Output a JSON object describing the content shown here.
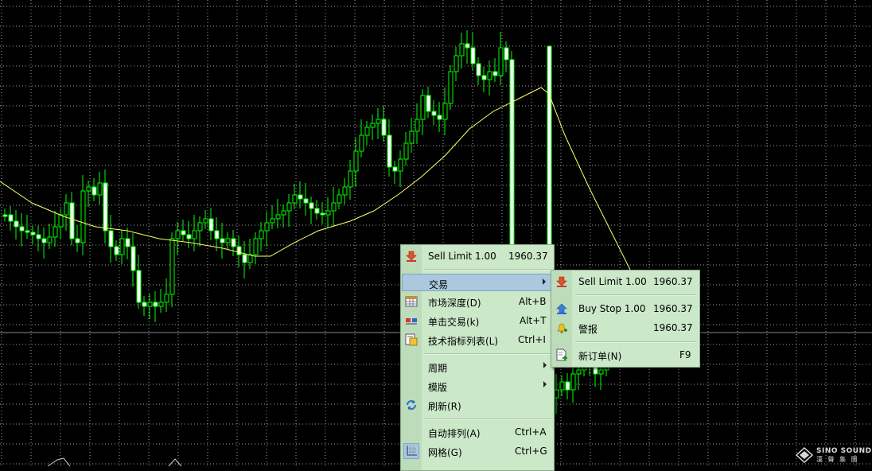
{
  "chart": {
    "bull_color": "#00ff00",
    "bear_color": "#00ff00",
    "ma_color": "#ffff66",
    "grid_color": "#a0a0a0",
    "background": "#000000",
    "price_line_color": "#8a8a8a"
  },
  "context_menu": {
    "top_item": {
      "label": "Sell Limit 1.00",
      "price": "1960.37",
      "icon": "sell-arrow-icon"
    },
    "items": [
      {
        "label": "交易",
        "shortcut": "",
        "icon": "",
        "submenu": true
      },
      {
        "label": "市场深度(D)",
        "shortcut": "Alt+B",
        "icon": "market-depth-icon"
      },
      {
        "label": "单击交易(k)",
        "shortcut": "Alt+T",
        "icon": "one-click-trading-icon"
      },
      {
        "label": "技术指标列表(L)",
        "shortcut": "Ctrl+I",
        "icon": "indicators-list-icon"
      },
      {
        "label": "周期",
        "shortcut": "",
        "icon": "",
        "submenu": true
      },
      {
        "label": "模版",
        "shortcut": "",
        "icon": "",
        "submenu": true
      },
      {
        "label": "刷新(R)",
        "shortcut": "",
        "icon": "refresh-icon"
      },
      {
        "label": "自动排列(A)",
        "shortcut": "Ctrl+A",
        "icon": ""
      },
      {
        "label": "网格(G)",
        "shortcut": "Ctrl+G",
        "icon": "grid-icon"
      }
    ]
  },
  "submenu": {
    "items": [
      {
        "label": "Sell Limit 1.00",
        "price": "1960.37",
        "icon": "sell-arrow-icon"
      },
      {
        "label": "Buy Stop 1.00",
        "price": "1960.37",
        "icon": "buy-arrow-icon"
      },
      {
        "label": "警报",
        "price": "1960.37",
        "icon": "alert-bell-icon"
      },
      {
        "label": "新订单(N)",
        "price": "F9",
        "icon": "new-order-icon"
      }
    ]
  },
  "watermark": {
    "line1": "SINO SOUND",
    "line2": "漢 聲 集 團"
  }
}
